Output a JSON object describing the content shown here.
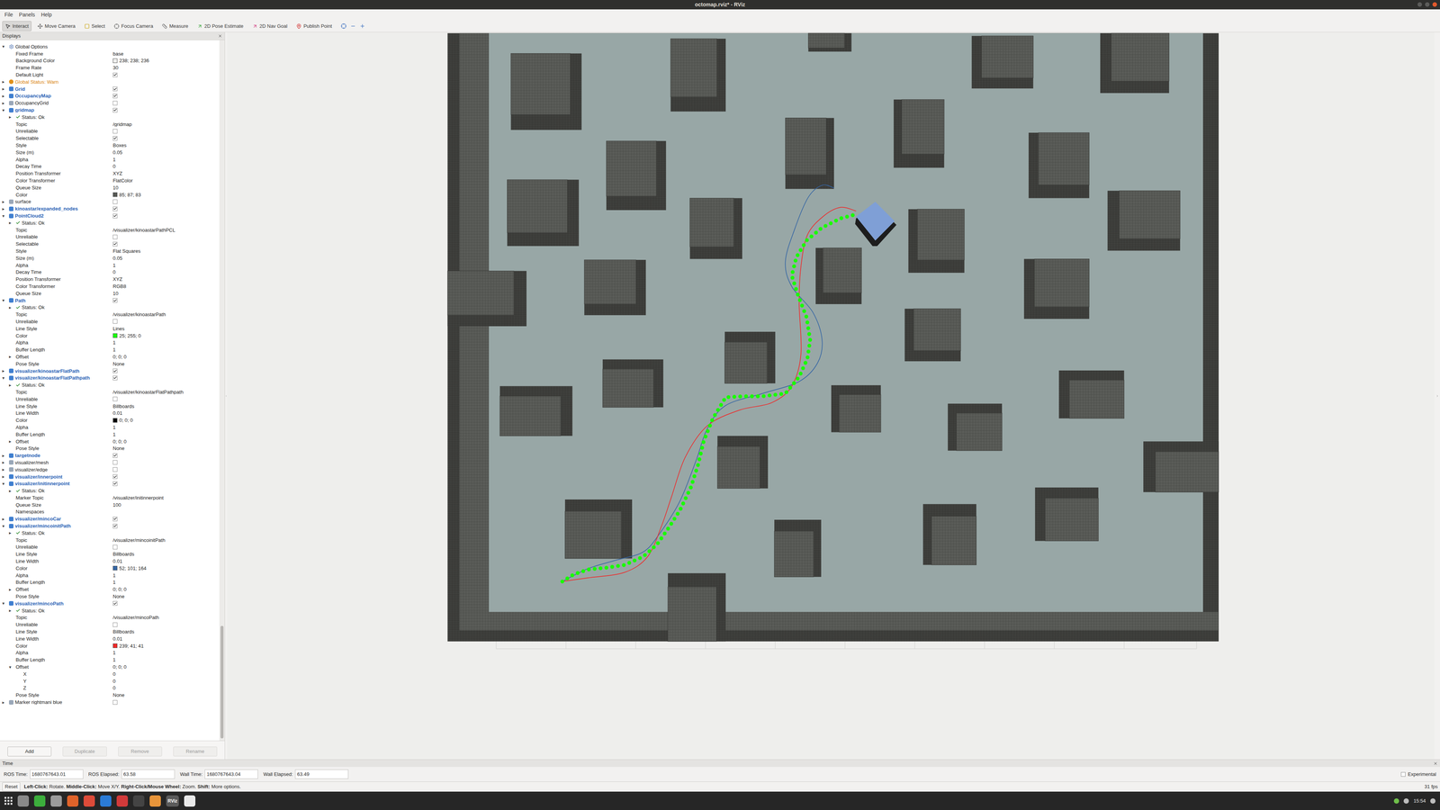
{
  "window": {
    "title": "octomap.rviz* - RViz"
  },
  "menu": [
    "File",
    "Panels",
    "Help"
  ],
  "toolbar": [
    {
      "label": "Interact",
      "selected": true
    },
    {
      "label": "Move Camera",
      "selected": false
    },
    {
      "label": "Select",
      "selected": false
    },
    {
      "label": "Focus Camera",
      "selected": false
    },
    {
      "label": "Measure",
      "selected": false
    },
    {
      "label": "2D Pose Estimate",
      "selected": false
    },
    {
      "label": "2D Nav Goal",
      "selected": false
    },
    {
      "label": "Publish Point",
      "selected": false
    }
  ],
  "displays": {
    "title": "Displays",
    "rows": [
      {
        "label": "Global Options",
        "depth": 0,
        "expander": "▾",
        "kind": "group"
      },
      {
        "label": "Fixed Frame",
        "value": "base",
        "depth": 1,
        "expander": "",
        "kind": "prop"
      },
      {
        "label": "Background Color",
        "value": "238; 238; 236",
        "depth": 1,
        "expander": "",
        "kind": "color",
        "color": "#eeeeec"
      },
      {
        "label": "Frame Rate",
        "value": "30",
        "depth": 1,
        "expander": "",
        "kind": "prop"
      },
      {
        "label": "Default Light",
        "depth": 1,
        "expander": "",
        "kind": "check",
        "checked": true
      },
      {
        "label": "Global Status: Warn",
        "depth": 0,
        "expander": "▸",
        "kind": "status",
        "ok": false
      },
      {
        "label": "Grid",
        "depth": 0,
        "expander": "▸",
        "kind": "display",
        "checked": true
      },
      {
        "label": "OccupancyMap",
        "depth": 0,
        "expander": "▸",
        "kind": "display",
        "checked": true
      },
      {
        "label": "OccupancyGrid",
        "depth": 0,
        "expander": "▸",
        "kind": "display",
        "checked": false
      },
      {
        "label": "gridmap",
        "depth": 0,
        "expander": "▾",
        "kind": "display",
        "checked": true
      },
      {
        "label": "Status: Ok",
        "depth": 1,
        "expander": "▸",
        "kind": "status",
        "ok": true
      },
      {
        "label": "Topic",
        "value": "/gridmap",
        "depth": 1,
        "expander": "",
        "kind": "prop"
      },
      {
        "label": "Unreliable",
        "depth": 1,
        "expander": "",
        "kind": "check",
        "checked": false
      },
      {
        "label": "Selectable",
        "depth": 1,
        "expander": "",
        "kind": "check",
        "checked": true
      },
      {
        "label": "Style",
        "value": "Boxes",
        "depth": 1,
        "expander": "",
        "kind": "prop"
      },
      {
        "label": "Size (m)",
        "value": "0.05",
        "depth": 1,
        "expander": "",
        "kind": "prop"
      },
      {
        "label": "Alpha",
        "value": "1",
        "depth": 1,
        "expander": "",
        "kind": "prop"
      },
      {
        "label": "Decay Time",
        "value": "0",
        "depth": 1,
        "expander": "",
        "kind": "prop"
      },
      {
        "label": "Position Transformer",
        "value": "XYZ",
        "depth": 1,
        "expander": "",
        "kind": "prop"
      },
      {
        "label": "Color Transformer",
        "value": "FlatColor",
        "depth": 1,
        "expander": "",
        "kind": "prop"
      },
      {
        "label": "Queue Size",
        "value": "10",
        "depth": 1,
        "expander": "",
        "kind": "prop"
      },
      {
        "label": "Color",
        "value": "85; 87; 83",
        "depth": 1,
        "expander": "",
        "kind": "color",
        "color": "#555753"
      },
      {
        "label": "surface",
        "depth": 0,
        "expander": "▸",
        "kind": "display",
        "checked": false
      },
      {
        "label": "kinoastar/expanded_nodes",
        "depth": 0,
        "expander": "▸",
        "kind": "display",
        "checked": true
      },
      {
        "label": "PointCloud2",
        "depth": 0,
        "expander": "▾",
        "kind": "display",
        "checked": true
      },
      {
        "label": "Status: Ok",
        "depth": 1,
        "expander": "▸",
        "kind": "status",
        "ok": true
      },
      {
        "label": "Topic",
        "value": "/visualizer/kinoastarPathPCL",
        "depth": 1,
        "expander": "",
        "kind": "prop"
      },
      {
        "label": "Unreliable",
        "depth": 1,
        "expander": "",
        "kind": "check",
        "checked": false
      },
      {
        "label": "Selectable",
        "depth": 1,
        "expander": "",
        "kind": "check",
        "checked": true
      },
      {
        "label": "Style",
        "value": "Flat Squares",
        "depth": 1,
        "expander": "",
        "kind": "prop"
      },
      {
        "label": "Size (m)",
        "value": "0.05",
        "depth": 1,
        "expander": "",
        "kind": "prop"
      },
      {
        "label": "Alpha",
        "value": "1",
        "depth": 1,
        "expander": "",
        "kind": "prop"
      },
      {
        "label": "Decay Time",
        "value": "0",
        "depth": 1,
        "expander": "",
        "kind": "prop"
      },
      {
        "label": "Position Transformer",
        "value": "XYZ",
        "depth": 1,
        "expander": "",
        "kind": "prop"
      },
      {
        "label": "Color Transformer",
        "value": "RGB8",
        "depth": 1,
        "expander": "",
        "kind": "prop"
      },
      {
        "label": "Queue Size",
        "value": "10",
        "depth": 1,
        "expander": "",
        "kind": "prop"
      },
      {
        "label": "Path",
        "depth": 0,
        "expander": "▾",
        "kind": "display",
        "checked": true
      },
      {
        "label": "Status: Ok",
        "depth": 1,
        "expander": "▸",
        "kind": "status",
        "ok": true
      },
      {
        "label": "Topic",
        "value": "/visualizer/kinoastarPath",
        "depth": 1,
        "expander": "",
        "kind": "prop"
      },
      {
        "label": "Unreliable",
        "depth": 1,
        "expander": "",
        "kind": "check",
        "checked": false
      },
      {
        "label": "Line Style",
        "value": "Lines",
        "depth": 1,
        "expander": "",
        "kind": "prop"
      },
      {
        "label": "Color",
        "value": "25; 255; 0",
        "depth": 1,
        "expander": "",
        "kind": "color",
        "color": "#19ff00"
      },
      {
        "label": "Alpha",
        "value": "1",
        "depth": 1,
        "expander": "",
        "kind": "prop"
      },
      {
        "label": "Buffer Length",
        "value": "1",
        "depth": 1,
        "expander": "",
        "kind": "prop"
      },
      {
        "label": "Offset",
        "value": "0; 0; 0",
        "depth": 1,
        "expander": "▸",
        "kind": "prop"
      },
      {
        "label": "Pose Style",
        "value": "None",
        "depth": 1,
        "expander": "",
        "kind": "prop"
      },
      {
        "label": "visualizer/kinoastarFlatPath",
        "depth": 0,
        "expander": "▸",
        "kind": "display",
        "checked": true
      },
      {
        "label": "visualizer/kinoastarFlatPathpath",
        "depth": 0,
        "expander": "▾",
        "kind": "display",
        "checked": true
      },
      {
        "label": "Status: Ok",
        "depth": 1,
        "expander": "▸",
        "kind": "status",
        "ok": true
      },
      {
        "label": "Topic",
        "value": "/visualizer/kinoastarFlatPathpath",
        "depth": 1,
        "expander": "",
        "kind": "prop"
      },
      {
        "label": "Unreliable",
        "depth": 1,
        "expander": "",
        "kind": "check",
        "checked": false
      },
      {
        "label": "Line Style",
        "value": "Billboards",
        "depth": 1,
        "expander": "",
        "kind": "prop"
      },
      {
        "label": "Line Width",
        "value": "0.01",
        "depth": 1,
        "expander": "",
        "kind": "prop"
      },
      {
        "label": "Color",
        "value": "0; 0; 0",
        "depth": 1,
        "expander": "",
        "kind": "color",
        "color": "#000000"
      },
      {
        "label": "Alpha",
        "value": "1",
        "depth": 1,
        "expander": "",
        "kind": "prop"
      },
      {
        "label": "Buffer Length",
        "value": "1",
        "depth": 1,
        "expander": "",
        "kind": "prop"
      },
      {
        "label": "Offset",
        "value": "0; 0; 0",
        "depth": 1,
        "expander": "▸",
        "kind": "prop"
      },
      {
        "label": "Pose Style",
        "value": "None",
        "depth": 1,
        "expander": "",
        "kind": "prop"
      },
      {
        "label": "targetnode",
        "depth": 0,
        "expander": "▸",
        "kind": "display",
        "checked": true
      },
      {
        "label": "visualizer/mesh",
        "depth": 0,
        "expander": "▸",
        "kind": "display",
        "checked": false
      },
      {
        "label": "visualizer/edge",
        "depth": 0,
        "expander": "▸",
        "kind": "display",
        "checked": false
      },
      {
        "label": "visualizer/innerpoint",
        "depth": 0,
        "expander": "▸",
        "kind": "display",
        "checked": true
      },
      {
        "label": "visualizer/initinnerpoint",
        "depth": 0,
        "expander": "▾",
        "kind": "display",
        "checked": true
      },
      {
        "label": "Status: Ok",
        "depth": 1,
        "expander": "▸",
        "kind": "status",
        "ok": true
      },
      {
        "label": "Marker Topic",
        "value": "/visualizer/initinnerpoint",
        "depth": 1,
        "expander": "",
        "kind": "prop"
      },
      {
        "label": "Queue Size",
        "value": "100",
        "depth": 1,
        "expander": "",
        "kind": "prop"
      },
      {
        "label": "Namespaces",
        "value": "",
        "depth": 1,
        "expander": "",
        "kind": "prop"
      },
      {
        "label": "visualizer/mincoCar",
        "depth": 0,
        "expander": "▸",
        "kind": "display",
        "checked": true
      },
      {
        "label": "visualizer/mincoinitPath",
        "depth": 0,
        "expander": "▾",
        "kind": "display",
        "checked": true
      },
      {
        "label": "Status: Ok",
        "depth": 1,
        "expander": "▸",
        "kind": "status",
        "ok": true
      },
      {
        "label": "Topic",
        "value": "/visualizer/mincoinitPath",
        "depth": 1,
        "expander": "",
        "kind": "prop"
      },
      {
        "label": "Unreliable",
        "depth": 1,
        "expander": "",
        "kind": "check",
        "checked": false
      },
      {
        "label": "Line Style",
        "value": "Billboards",
        "depth": 1,
        "expander": "",
        "kind": "prop"
      },
      {
        "label": "Line Width",
        "value": "0.01",
        "depth": 1,
        "expander": "",
        "kind": "prop"
      },
      {
        "label": "Color",
        "value": "52; 101; 164",
        "depth": 1,
        "expander": "",
        "kind": "color",
        "color": "#3465a4"
      },
      {
        "label": "Alpha",
        "value": "1",
        "depth": 1,
        "expander": "",
        "kind": "prop"
      },
      {
        "label": "Buffer Length",
        "value": "1",
        "depth": 1,
        "expander": "",
        "kind": "prop"
      },
      {
        "label": "Offset",
        "value": "0; 0; 0",
        "depth": 1,
        "expander": "▸",
        "kind": "prop"
      },
      {
        "label": "Pose Style",
        "value": "None",
        "depth": 1,
        "expander": "",
        "kind": "prop"
      },
      {
        "label": "visualizer/mincoPath",
        "depth": 0,
        "expander": "▾",
        "kind": "display",
        "checked": true
      },
      {
        "label": "Status: Ok",
        "depth": 1,
        "expander": "▸",
        "kind": "status",
        "ok": true
      },
      {
        "label": "Topic",
        "value": "/visualizer/mincoPath",
        "depth": 1,
        "expander": "",
        "kind": "prop"
      },
      {
        "label": "Unreliable",
        "depth": 1,
        "expander": "",
        "kind": "check",
        "checked": false
      },
      {
        "label": "Line Style",
        "value": "Billboards",
        "depth": 1,
        "expander": "",
        "kind": "prop"
      },
      {
        "label": "Line Width",
        "value": "0.01",
        "depth": 1,
        "expander": "",
        "kind": "prop"
      },
      {
        "label": "Color",
        "value": "239; 41; 41",
        "depth": 1,
        "expander": "",
        "kind": "color",
        "color": "#ef2929"
      },
      {
        "label": "Alpha",
        "value": "1",
        "depth": 1,
        "expander": "",
        "kind": "prop"
      },
      {
        "label": "Buffer Length",
        "value": "1",
        "depth": 1,
        "expander": "",
        "kind": "prop"
      },
      {
        "label": "Offset",
        "value": "0; 0; 0",
        "depth": 1,
        "expander": "▾",
        "kind": "prop"
      },
      {
        "label": "X",
        "value": "0",
        "depth": 2,
        "expander": "",
        "kind": "prop"
      },
      {
        "label": "Y",
        "value": "0",
        "depth": 2,
        "expander": "",
        "kind": "prop"
      },
      {
        "label": "Z",
        "value": "0",
        "depth": 2,
        "expander": "",
        "kind": "prop"
      },
      {
        "label": "Pose Style",
        "value": "None",
        "depth": 1,
        "expander": "",
        "kind": "prop"
      },
      {
        "label": "Marker rightmani blue",
        "depth": 0,
        "expander": "▸",
        "kind": "display",
        "checked": false
      }
    ],
    "buttons": [
      {
        "label": "Add",
        "disabled": false
      },
      {
        "label": "Duplicate",
        "disabled": true
      },
      {
        "label": "Remove",
        "disabled": true
      },
      {
        "label": "Rename",
        "disabled": true
      }
    ]
  },
  "time": {
    "title": "Time",
    "fields": [
      {
        "label": "ROS Time:",
        "value": "1680767643.01"
      },
      {
        "label": "ROS Elapsed:",
        "value": "63.58"
      },
      {
        "label": "Wall Time:",
        "value": "1680767643.04"
      },
      {
        "label": "Wall Elapsed:",
        "value": "63.49"
      }
    ],
    "experimental": {
      "label": "Experimental",
      "checked": false
    }
  },
  "status_bar": {
    "button": "Reset",
    "hint": [
      {
        "text": "Left-Click:",
        "bold": true
      },
      {
        "text": " Rotate. ",
        "bold": false
      },
      {
        "text": "Middle-Click:",
        "bold": true
      },
      {
        "text": " Move X/Y. ",
        "bold": false
      },
      {
        "text": "Right-Click/Mouse Wheel:",
        "bold": true
      },
      {
        "text": " Zoom. ",
        "bold": false
      },
      {
        "text": "Shift:",
        "bold": true
      },
      {
        "text": " More options.",
        "bold": false
      }
    ],
    "fps": "31 fps"
  },
  "taskbar": {
    "app_label": "RViz",
    "clock": "15:54"
  }
}
